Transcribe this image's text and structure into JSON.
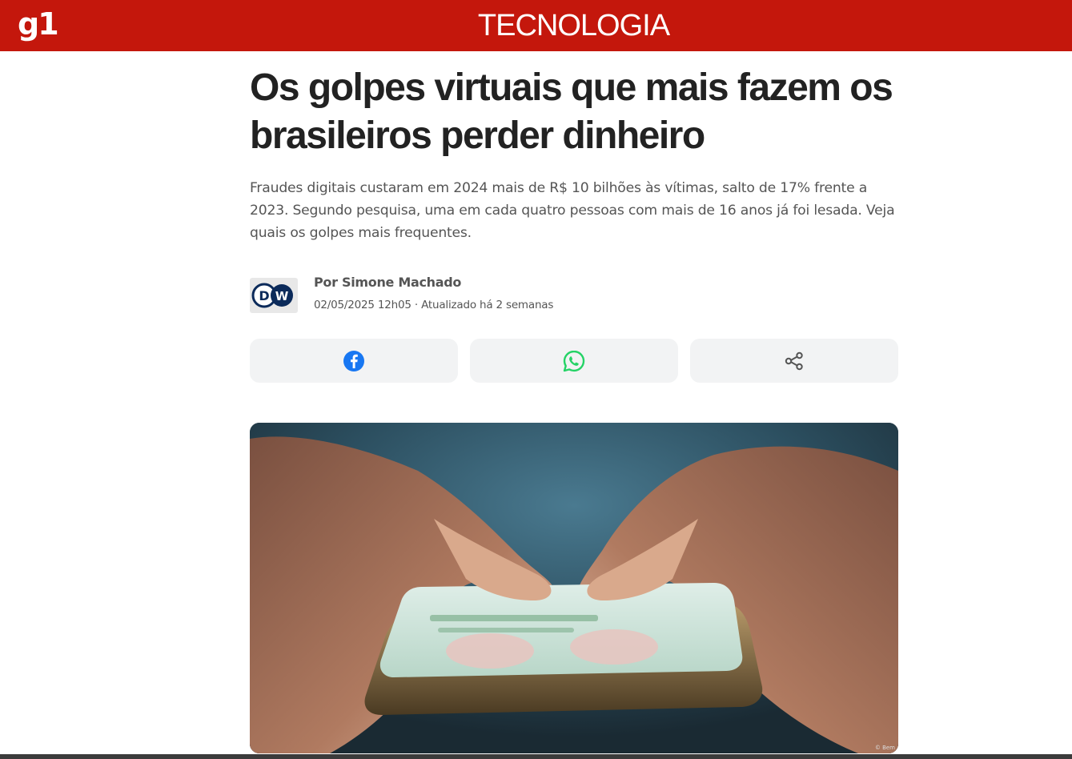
{
  "header": {
    "logo": "g1",
    "section": "TECNOLOGIA",
    "background_color": "#c4170c"
  },
  "article": {
    "headline": "Os golpes virtuais que mais fazem os brasileiros perder dinheiro",
    "subtitle": "Fraudes digitais custaram em 2024 mais de R$ 10 bilhões às vítimas, salto de 17% frente a 2023. Segundo pesquisa, uma em cada quatro pessoas com mais de 16 anos já foi lesada. Veja quais os golpes mais frequentes.",
    "author": "Por Simone Machado",
    "dateline": "02/05/2025 12h05 · Atualizado há 2 semanas",
    "source_logo": "DW",
    "image_credit": "© Bem"
  },
  "share": {
    "buttons": [
      {
        "icon": "facebook-icon",
        "color": "#1877f2"
      },
      {
        "icon": "whatsapp-icon",
        "color": "#25d366"
      },
      {
        "icon": "share-icon",
        "color": "#555555"
      }
    ]
  }
}
